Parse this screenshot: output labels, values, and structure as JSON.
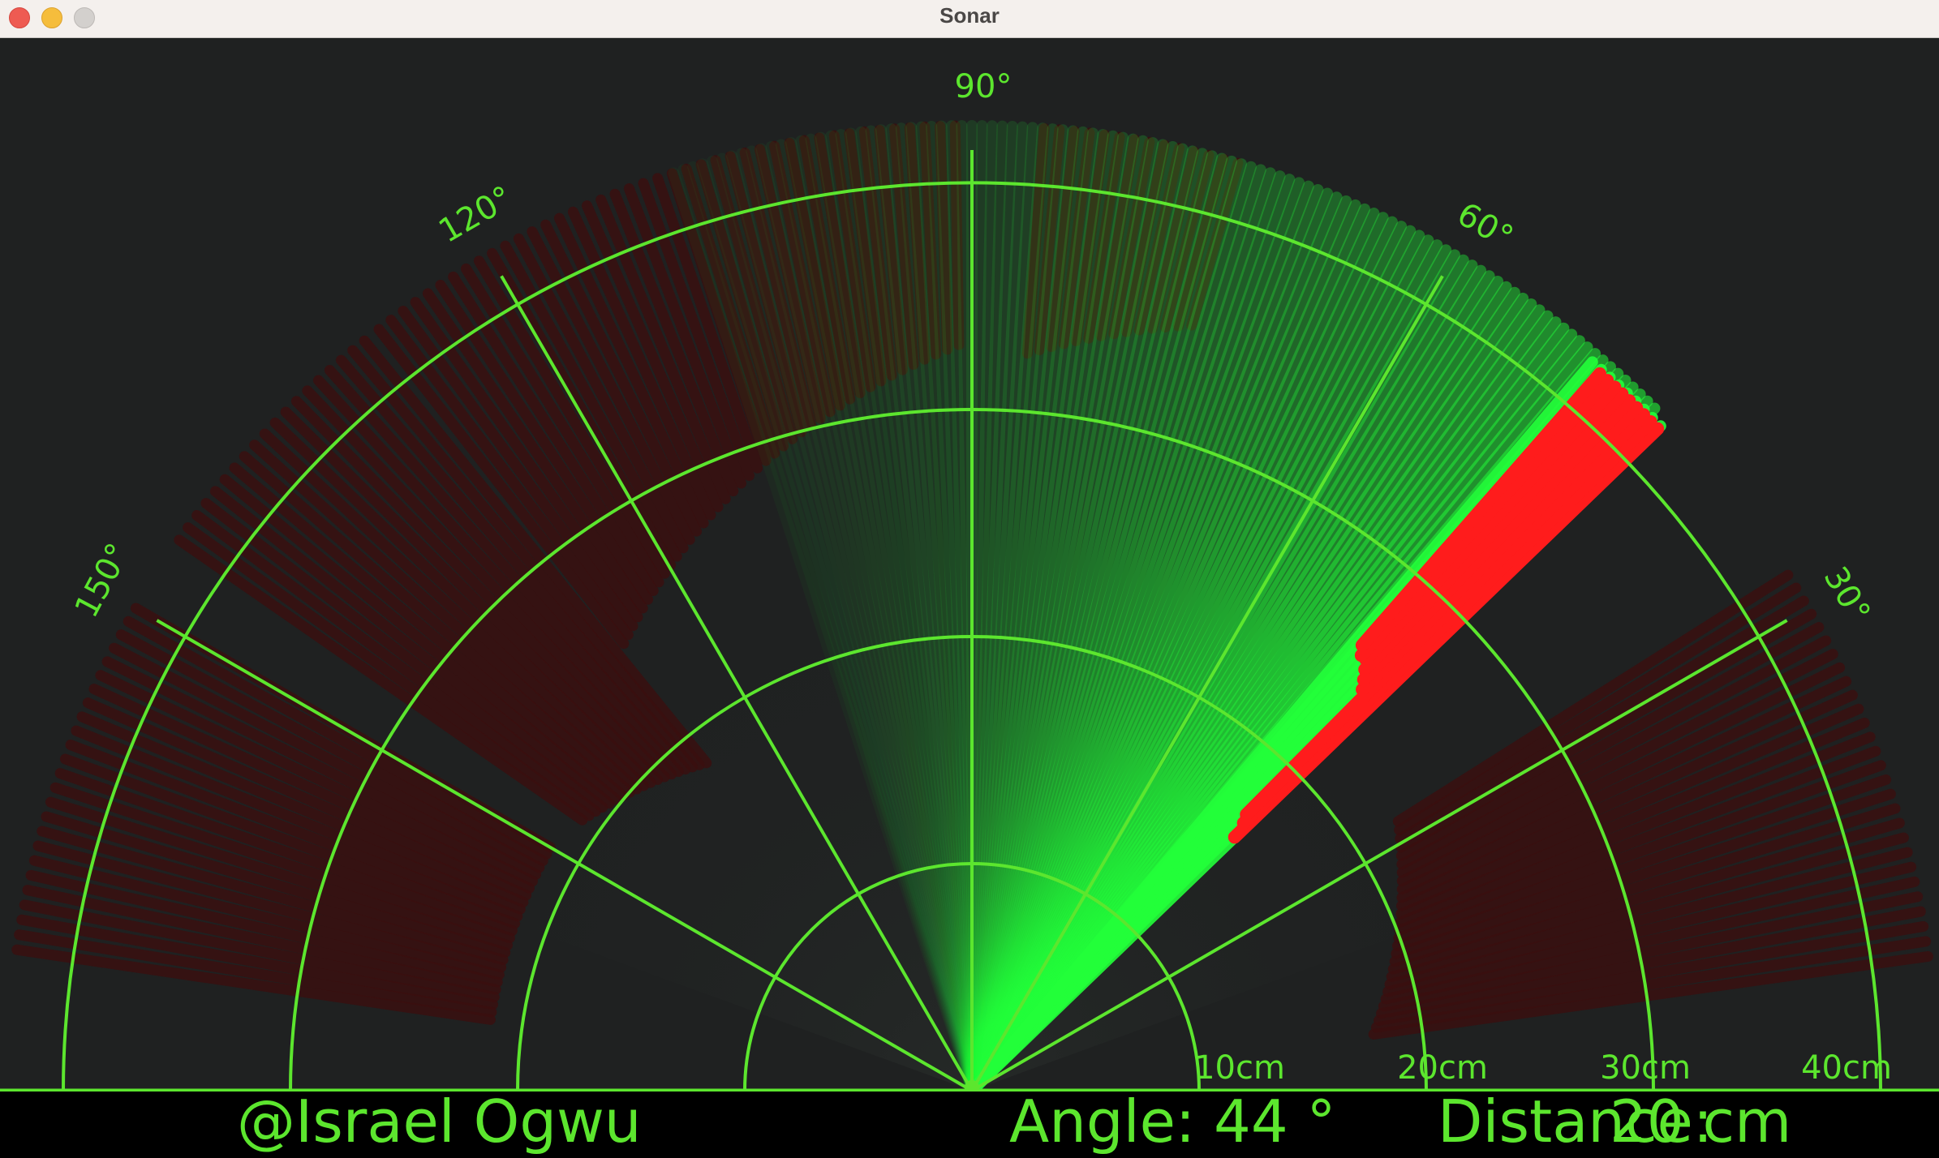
{
  "window": {
    "title": "Sonar"
  },
  "radar": {
    "angle_labels": [
      "150°",
      "120°",
      "90°",
      "60°",
      "30°"
    ],
    "range_labels": [
      "10cm",
      "20cm",
      "30cm",
      "40cm"
    ],
    "current_angle_deg": 44,
    "max_range_cm": 40,
    "colors": {
      "grid": "#5ce62e",
      "sweep": "#22ff3a",
      "detect_bright": "#ff1c1c",
      "detect_faded": "#3a0f0f",
      "background": "#1f2121"
    }
  },
  "status": {
    "author": "@Israel Ogwu",
    "angle_text": "Angle: 44 °",
    "distance_label": "Distance:",
    "distance_value": "20 cm"
  }
}
